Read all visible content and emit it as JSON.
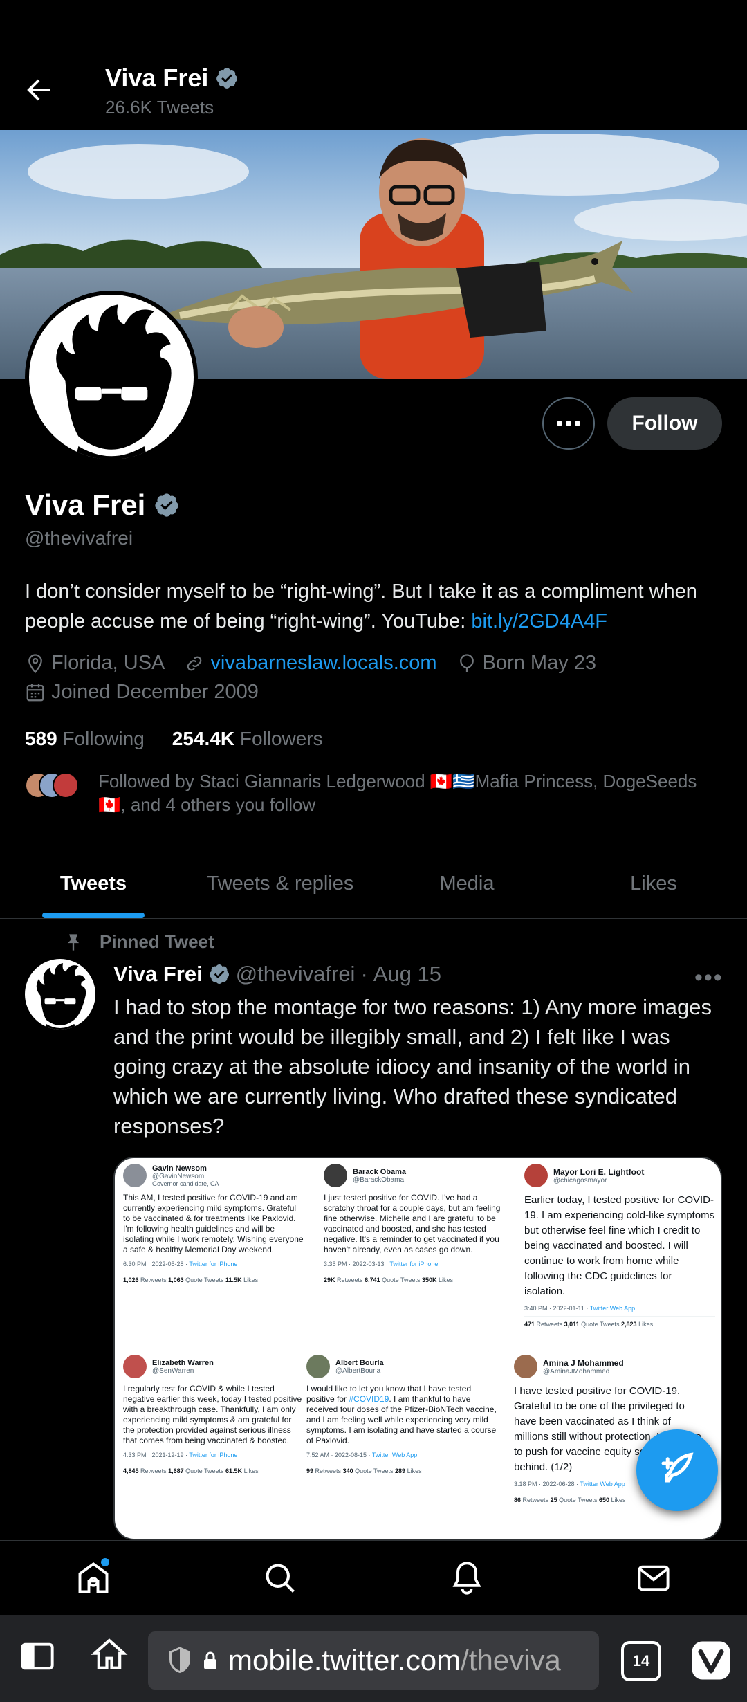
{
  "header": {
    "name": "Viva Frei",
    "tweet_count": "26.6K Tweets"
  },
  "profile": {
    "name": "Viva Frei",
    "handle": "@thevivafrei",
    "bio_text": "I don’t consider myself to be “right-wing”. But I take it as a compliment when people accuse me of being “right-wing”. YouTube: ",
    "bio_link": "bit.ly/2GD4A4F",
    "location": "Florida, USA",
    "website": "vivabarneslaw.locals.com",
    "birthday": "Born May 23",
    "joined": "Joined December 2009",
    "following_count": "589",
    "following_label": "Following",
    "followers_count": "254.4K",
    "followers_label": "Followers",
    "followed_by": "Followed by Staci Giannaris Ledgerwood 🇨🇦🇬🇷Mafia Princess, DogeSeeds 🇨🇦, and 4 others you follow",
    "follow_button": "Follow"
  },
  "tabs": [
    {
      "label": "Tweets",
      "active": true
    },
    {
      "label": "Tweets & replies",
      "active": false
    },
    {
      "label": "Media",
      "active": false
    },
    {
      "label": "Likes",
      "active": false
    }
  ],
  "pinned": {
    "label": "Pinned Tweet",
    "name": "Viva Frei",
    "handle": "@thevivafrei",
    "sep": "·",
    "date": "Aug 15",
    "text": "I had to stop the montage for two reasons: 1) Any more images and the print would be illegibly small, and 2) I felt like I was going crazy at the absolute idiocy and insanity of the world in which we are currently living. Who drafted these syndicated responses?"
  },
  "montage": [
    {
      "name": "Gavin Newsom",
      "handle": "@GavinNewsom",
      "sub": "Governor candidate, CA",
      "body": "This AM, I tested positive for COVID-19 and am currently experiencing mild symptoms. Grateful to be vaccinated & for treatments like Paxlovid. I'm following health guidelines and will be isolating while I work remotely. Wishing everyone a safe & healthy Memorial Day weekend.",
      "time": "6:30 PM · 2022-05-28 ·",
      "client": "Twitter for iPhone",
      "rt": "1,026",
      "qt": "1,063",
      "likes": "11.5K",
      "avatar_color": "#8a8f98"
    },
    {
      "name": "Barack Obama",
      "handle": "@BarackObama",
      "sub": "",
      "body": "I just tested positive for COVID. I've had a scratchy throat for a couple days, but am feeling fine otherwise. Michelle and I are grateful to be vaccinated and boosted, and she has tested negative. It's a reminder to get vaccinated if you haven't already, even as cases go down.",
      "time": "3:35 PM · 2022-03-13 ·",
      "client": "Twitter for iPhone",
      "rt": "29K",
      "qt": "6,741",
      "likes": "350K",
      "avatar_color": "#3b3b3b"
    },
    {
      "name": "Mayor Lori E. Lightfoot",
      "handle": "@chicagosmayor",
      "sub": "",
      "body": "Earlier today, I tested positive for COVID-19. I am experiencing cold-like symptoms but otherwise feel fine which I credit to being vaccinated and boosted. I will continue to work from home while following the CDC guidelines for isolation.",
      "time": "3:40 PM · 2022-01-11 ·",
      "client": "Twitter Web App",
      "rt": "471",
      "qt": "3,011",
      "likes": "2,823",
      "avatar_color": "#b5413a"
    },
    {
      "name": "Elizabeth Warren",
      "handle": "@SenWarren",
      "sub": "",
      "body": "I regularly test for COVID & while I tested negative earlier this week, today I tested positive with a breakthrough case. Thankfully, I am only experiencing mild symptoms & am grateful for the protection provided against serious illness that comes from being vaccinated & boosted.",
      "time": "4:33 PM · 2021-12-19 ·",
      "client": "Twitter for iPhone",
      "rt": "4,845",
      "qt": "1,687",
      "likes": "61.5K",
      "avatar_color": "#c0504d"
    },
    {
      "name": "Albert Bourla",
      "handle": "@AlbertBourla",
      "sub": "",
      "body_pre": "I would like to let you know that I have tested positive for ",
      "body_tag": "#COVID19",
      "body_post": ". I am thankful to have received four doses of the Pfizer-BioNTech vaccine, and I am feeling well while experiencing very mild symptoms. I am isolating and have started a course of Paxlovid.",
      "time": "7:52 AM · 2022-08-15 ·",
      "client": "Twitter Web App",
      "rt": "99",
      "qt": "340",
      "likes": "289",
      "avatar_color": "#6c7a5e"
    },
    {
      "name": "Amina J Mohammed",
      "handle": "@AminaJMohammed",
      "sub": "",
      "body": "I have tested positive for COVID-19. Grateful to be one of the privileged to have been vaccinated as I think of millions still without protection. I continue to push for vaccine equity so no one behind. (1/2)",
      "time": "3:18 PM · 2022-06-28 ·",
      "client": "Twitter Web App",
      "rt": "86",
      "qt": "25",
      "likes": "650",
      "avatar_color": "#9b6b4e"
    }
  ],
  "montage_labels": {
    "rt": "Retweets",
    "qt": "Quote Tweets",
    "likes": "Likes"
  },
  "nav": {
    "home": "home-icon",
    "search": "search-icon",
    "notifications": "bell-icon",
    "messages": "mail-icon"
  },
  "browser": {
    "url_domain": "mobile.twitter.com",
    "url_path": "/theviva",
    "tab_count": "14"
  },
  "colors": {
    "accent": "#1d9bf0",
    "background": "#000000",
    "muted": "#71767b"
  }
}
